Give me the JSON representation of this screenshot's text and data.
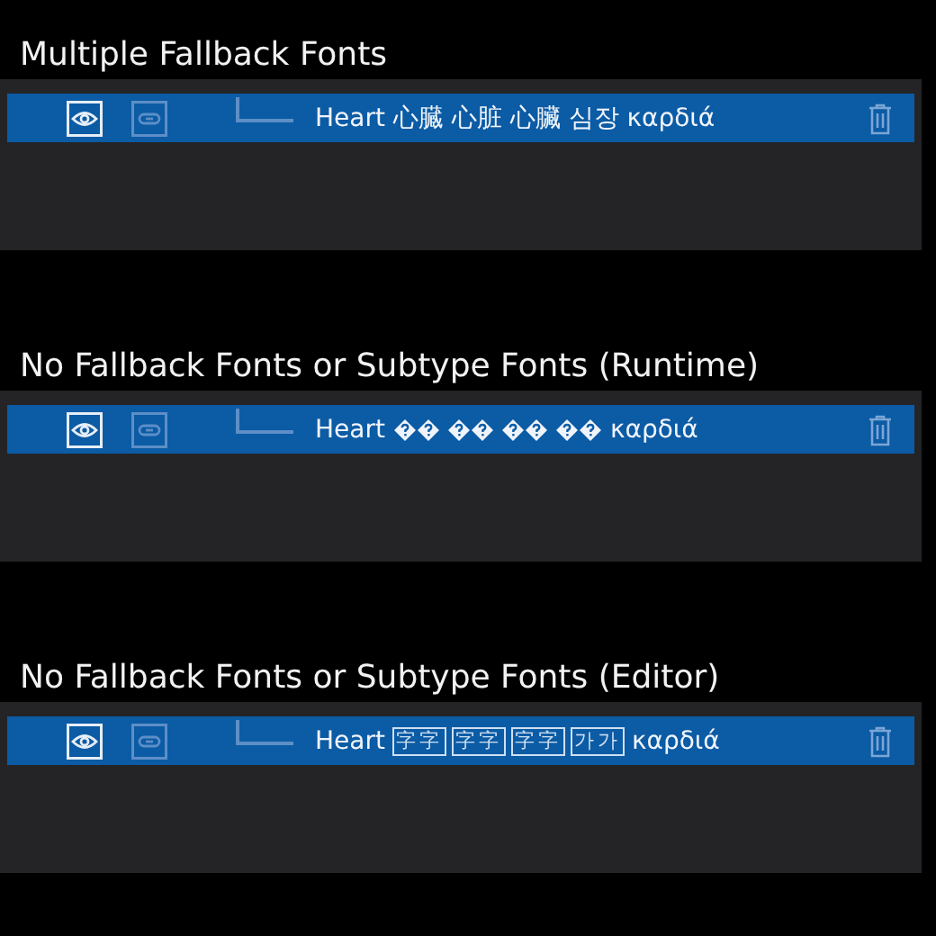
{
  "sections": [
    {
      "title": "Multiple Fallback Fonts",
      "layer": {
        "visible": true,
        "linked": false,
        "label": [
          {
            "kind": "text",
            "text": "Heart 心臓 心脏 心臟 심장 καρδιά"
          }
        ]
      }
    },
    {
      "title": "No Fallback Fonts or Subtype Fonts (Runtime)",
      "layer": {
        "visible": true,
        "linked": false,
        "label": [
          {
            "kind": "text",
            "text": "Heart"
          },
          {
            "kind": "missing_pair"
          },
          {
            "kind": "missing_pair"
          },
          {
            "kind": "missing_pair"
          },
          {
            "kind": "missing_pair"
          },
          {
            "kind": "text",
            "text": "καρδιά"
          }
        ]
      }
    },
    {
      "title": "No Fallback Fonts or Subtype Fonts (Editor)",
      "layer": {
        "visible": true,
        "linked": false,
        "label": [
          {
            "kind": "text",
            "text": "Heart"
          },
          {
            "kind": "tofu",
            "text": "字字"
          },
          {
            "kind": "tofu",
            "text": "字字"
          },
          {
            "kind": "tofu",
            "text": "字字"
          },
          {
            "kind": "tofu",
            "text": "가가"
          },
          {
            "kind": "text",
            "text": "καρδιά"
          }
        ]
      }
    }
  ]
}
